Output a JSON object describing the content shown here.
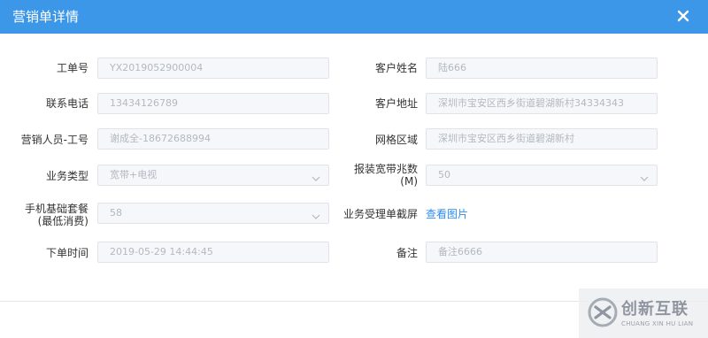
{
  "dialog": {
    "title": "营销单详情"
  },
  "form": {
    "order_no": {
      "label": "工单号",
      "value": "YX2019052900004"
    },
    "customer_name": {
      "label": "客户姓名",
      "value": "陆666"
    },
    "phone": {
      "label": "联系电话",
      "value": "13434126789"
    },
    "address": {
      "label": "客户地址",
      "value": "深圳市宝安区西乡街道碧湖新村34334343"
    },
    "sales_staff": {
      "label": "营销人员-工号",
      "value": "谢成全-18672688994"
    },
    "grid_area": {
      "label": "网格区域",
      "value": "深圳市宝安区西乡街道碧湖新村"
    },
    "business_type": {
      "label": "业务类型",
      "value": "宽带+电视"
    },
    "bandwidth": {
      "label_line1": "报装宽带兆数",
      "label_line2": "(M)",
      "value": "50"
    },
    "mobile_plan": {
      "label_line1": "手机基础套餐",
      "label_line2": "(最低消费)",
      "value": "58"
    },
    "screenshot": {
      "label": "业务受理单截屏",
      "link": "查看图片"
    },
    "order_time": {
      "label": "下单时间",
      "value": "2019-05-29 14:44:45"
    },
    "remark": {
      "label": "备注",
      "value": "备注6666"
    }
  },
  "icons": {
    "close": "close-icon",
    "select": "chevron-down-icon",
    "watermark_logo": "swirl-logo"
  },
  "watermark": {
    "text": "创新互联",
    "subtext": "CHUANG XIN HU LIAN"
  },
  "colors": {
    "header": "#3d97e8",
    "field_bg": "#f5f7fa",
    "field_border": "#e1e3e8",
    "link": "#2d8cf0"
  }
}
